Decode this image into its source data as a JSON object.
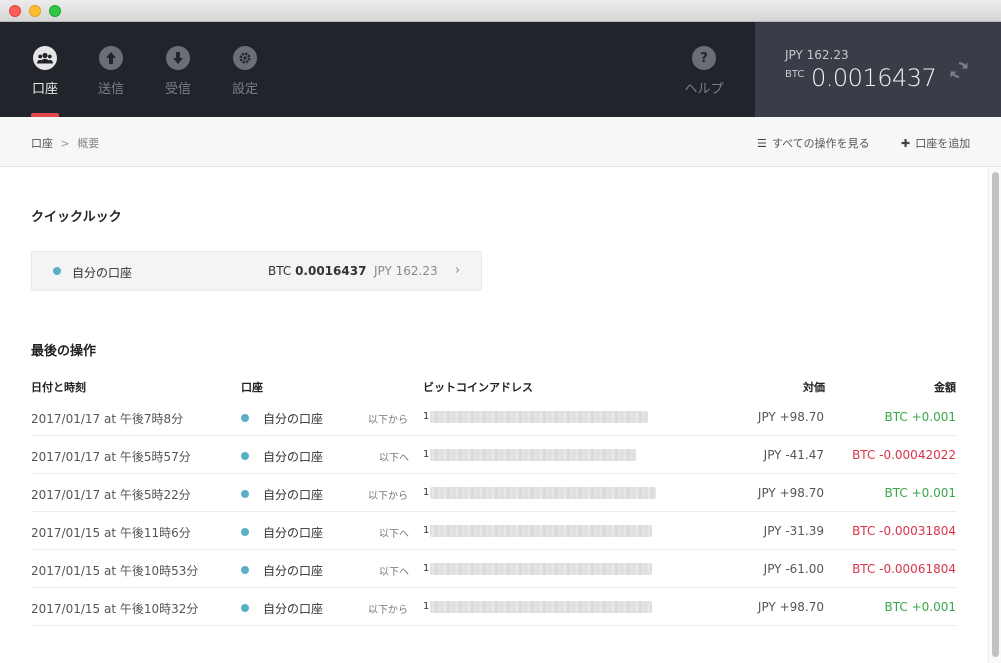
{
  "nav": {
    "items": [
      {
        "label": "口座",
        "icon": "users-icon",
        "active": true
      },
      {
        "label": "送信",
        "icon": "arrow-up-icon",
        "active": false
      },
      {
        "label": "受信",
        "icon": "arrow-down-icon",
        "active": false
      },
      {
        "label": "設定",
        "icon": "gear-icon",
        "active": false
      }
    ],
    "help_label": "ヘルプ"
  },
  "balance": {
    "jpy": "JPY 162.23",
    "btc_currency": "BTC",
    "btc_value": "0.0016437"
  },
  "breadcrumb": {
    "parent": "口座",
    "separator": ">",
    "current": "概要"
  },
  "actions": {
    "view_all": "すべての操作を見る",
    "add_account": "口座を追加"
  },
  "quicklook": {
    "heading": "クイックルック",
    "account_name": "自分の口座",
    "btc_currency": "BTC",
    "btc_value": "0.0016437",
    "jpy": "JPY 162.23",
    "chevron": "›"
  },
  "recent": {
    "heading": "最後の操作",
    "columns": {
      "date": "日付と時刻",
      "account": "口座",
      "address": "ビットコインアドレス",
      "value": "対価",
      "amount": "金額"
    },
    "rows": [
      {
        "date": "2017/01/17 at 午後7時8分",
        "account": "自分の口座",
        "direction": "以下から",
        "address_prefix": "1",
        "jpy": "JPY +98.70",
        "btc": "BTC +0.001",
        "sign": "pos"
      },
      {
        "date": "2017/01/17 at 午後5時57分",
        "account": "自分の口座",
        "direction": "以下へ",
        "address_prefix": "1",
        "jpy": "JPY -41.47",
        "btc": "BTC -0.00042022",
        "sign": "neg"
      },
      {
        "date": "2017/01/17 at 午後5時22分",
        "account": "自分の口座",
        "direction": "以下から",
        "address_prefix": "1",
        "jpy": "JPY +98.70",
        "btc": "BTC +0.001",
        "sign": "pos"
      },
      {
        "date": "2017/01/15 at 午後11時6分",
        "account": "自分の口座",
        "direction": "以下へ",
        "address_prefix": "1",
        "jpy": "JPY -31.39",
        "btc": "BTC -0.00031804",
        "sign": "neg"
      },
      {
        "date": "2017/01/15 at 午後10時53分",
        "account": "自分の口座",
        "direction": "以下へ",
        "address_prefix": "1",
        "jpy": "JPY -61.00",
        "btc": "BTC -0.00061804",
        "sign": "neg"
      },
      {
        "date": "2017/01/15 at 午後10時32分",
        "account": "自分の口座",
        "direction": "以下から",
        "address_prefix": "1",
        "jpy": "JPY +98.70",
        "btc": "BTC +0.001",
        "sign": "pos"
      }
    ]
  },
  "colors": {
    "nav_bg": "#22242c",
    "balance_bg": "#3a3d47",
    "active_accent": "#e4474f",
    "positive": "#39a84a",
    "negative": "#d9344a",
    "account_dot": "#5aaec6"
  }
}
